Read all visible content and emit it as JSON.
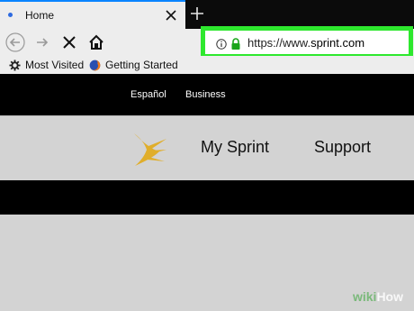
{
  "browser": {
    "tab": {
      "title": "Home",
      "close_icon": "close-icon"
    },
    "new_tab_icon": "plus-icon",
    "nav": {
      "back_icon": "arrow-left-icon",
      "forward_icon": "arrow-right-icon",
      "stop_icon": "close-icon",
      "home_icon": "home-icon"
    },
    "url": {
      "prefix": "https://www.",
      "domain": "sprint.com",
      "highlight_color": "#2ee82e"
    },
    "bookmarks": [
      {
        "label": "Most Visited",
        "icon": "gear-icon"
      },
      {
        "label": "Getting Started",
        "icon": "firefox-icon"
      }
    ]
  },
  "site": {
    "top_links": [
      "Español",
      "Business"
    ],
    "logo": "sprint-logo",
    "logo_color": "#e0ae2b",
    "nav": [
      "My Sprint",
      "Support"
    ]
  },
  "watermark": {
    "part1": "wiki",
    "part2": "How"
  }
}
